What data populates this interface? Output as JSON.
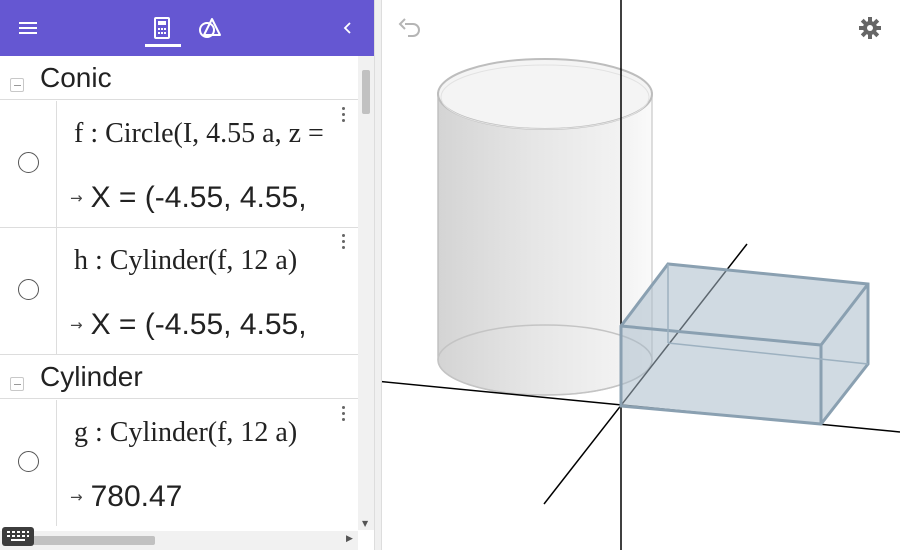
{
  "toolbar": {
    "menu_icon": "hamburger-menu-icon",
    "calculator_icon": "calculator-icon",
    "geometry_tools_icon": "geometry-tools-icon",
    "collapse_icon": "chevron-left-icon",
    "background_color": "#6557d2"
  },
  "algebra": {
    "groups": [
      {
        "title": "Conic",
        "items": [
          {
            "definition": "f : Circle(I, 4.55 a, z =",
            "output": "X = (-4.55, 4.55,"
          },
          {
            "definition": "h : Cylinder(f, 12 a)",
            "output": "X = (-4.55, 4.55,"
          }
        ]
      },
      {
        "title": "Cylinder",
        "items": [
          {
            "definition": "g : Cylinder(f, 12 a)",
            "output": "780.47"
          }
        ]
      }
    ],
    "output_arrow": "→"
  },
  "graphics": {
    "undo_icon": "undo-icon",
    "settings_icon": "gear-icon",
    "cylinder_color": "#d9d9d9",
    "box_color": "#a9bccb"
  },
  "keyboard_icon": "keyboard-icon"
}
